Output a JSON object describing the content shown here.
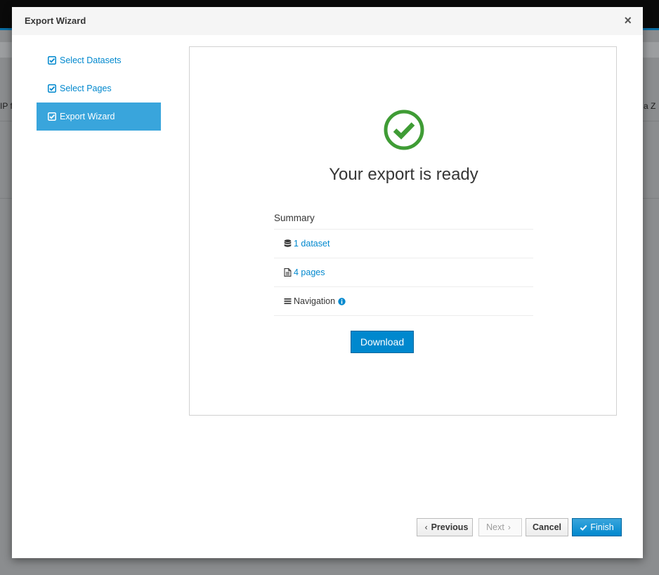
{
  "background": {
    "left_text": "IP f",
    "right_text": "n a Z"
  },
  "modal": {
    "title": "Export Wizard",
    "close_symbol": "×"
  },
  "steps": [
    {
      "label": "Select Datasets",
      "icon": "check-square-icon",
      "active": false
    },
    {
      "label": "Select Pages",
      "icon": "check-square-icon",
      "active": false
    },
    {
      "label": "Export Wizard",
      "icon": "check-square-icon",
      "active": true
    }
  ],
  "result": {
    "icon": "check-circle-icon",
    "title": "Your export is ready",
    "summary_title": "Summary",
    "items": [
      {
        "label": "1 dataset",
        "icon": "database-icon",
        "link": true
      },
      {
        "label": "4 pages",
        "icon": "file-icon",
        "link": true
      },
      {
        "label": "Navigation",
        "icon": "bars-icon",
        "link": false,
        "info_icon": "info-circle-icon"
      }
    ],
    "download_label": "Download"
  },
  "footer": {
    "previous_label": "Previous",
    "next_label": "Next",
    "cancel_label": "Cancel",
    "finish_label": "Finish"
  },
  "colors": {
    "accent": "#0088ce",
    "active_step": "#39a5dc",
    "success": "#3f9c35"
  }
}
